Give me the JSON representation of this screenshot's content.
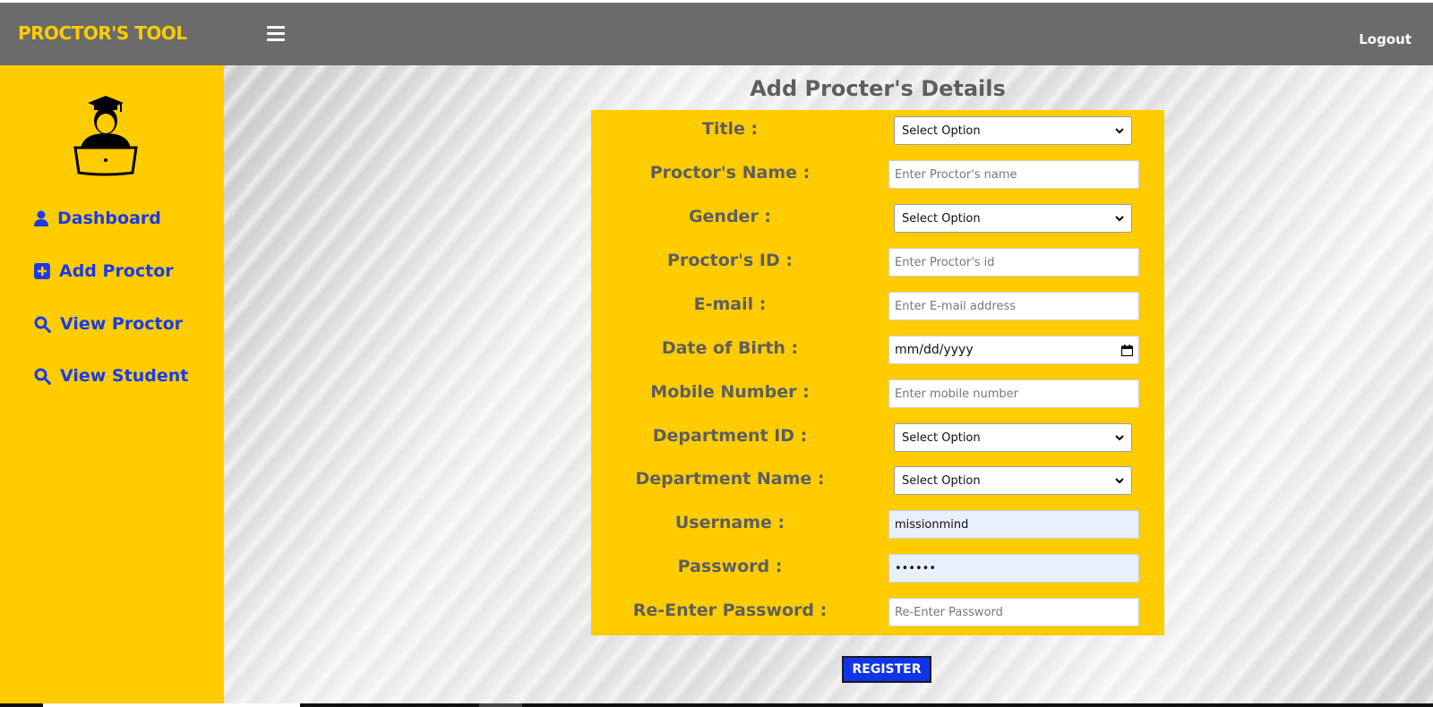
{
  "header": {
    "brand": "PROCTOR'S TOOL",
    "logout_label": "Logout"
  },
  "sidebar": {
    "items": [
      {
        "label": "Dashboard",
        "icon": "user-icon"
      },
      {
        "label": "Add Proctor",
        "icon": "plus-square-icon"
      },
      {
        "label": "View Proctor",
        "icon": "search-icon"
      },
      {
        "label": "View Student",
        "icon": "search-icon"
      }
    ]
  },
  "form": {
    "title": "Add Procter's Details",
    "fields": {
      "title": {
        "label": "Title :",
        "value": "Select Option"
      },
      "name": {
        "label": "Proctor's Name :",
        "placeholder": "Enter Proctor's name"
      },
      "gender": {
        "label": "Gender :",
        "value": "Select Option"
      },
      "id": {
        "label": "Proctor's ID :",
        "placeholder": "Enter Proctor's id"
      },
      "email": {
        "label": "E-mail :",
        "placeholder": "Enter E-mail address"
      },
      "dob": {
        "label": "Date of Birth :",
        "value": "mm/dd/yyyy"
      },
      "mobile": {
        "label": "Mobile Number :",
        "placeholder": "Enter mobile number"
      },
      "dept_id": {
        "label": "Department ID :",
        "value": "Select Option"
      },
      "dept_name": {
        "label": "Department Name :",
        "value": "Select Option"
      },
      "username": {
        "label": "Username :",
        "value": "missionmind"
      },
      "password": {
        "label": "Password :",
        "value": "••••••"
      },
      "repassword": {
        "label": "Re-Enter Password :",
        "placeholder": "Re-Enter Password"
      }
    },
    "register_label": "REGISTER"
  },
  "colors": {
    "accent_yellow": "#ffcc00",
    "header_gray": "#6b6b6b",
    "nav_blue": "#1a3be8",
    "button_blue": "#1034e8"
  }
}
